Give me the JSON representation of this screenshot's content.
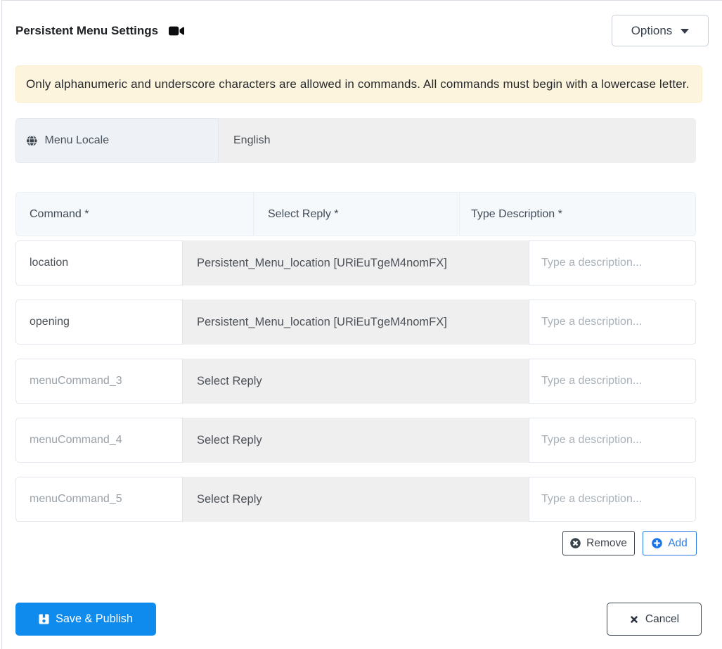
{
  "header": {
    "title": "Persistent Menu Settings",
    "options_label": "Options"
  },
  "alert": {
    "text": "Only alphanumeric and underscore characters are allowed in commands. All commands must begin with a lowercase letter."
  },
  "locale": {
    "label": "Menu Locale",
    "value": "English"
  },
  "table": {
    "columns": [
      "Command *",
      "Select Reply *",
      "Type Description *"
    ],
    "rows": [
      {
        "command": "location",
        "command_placeholder": "",
        "reply": "Persistent_Menu_location [URiEuTgeM4nomFX]",
        "description_value": "",
        "description_placeholder": "Type a description..."
      },
      {
        "command": "opening",
        "command_placeholder": "",
        "reply": "Persistent_Menu_location [URiEuTgeM4nomFX]",
        "description_value": "",
        "description_placeholder": "Type a description..."
      },
      {
        "command": "",
        "command_placeholder": "menuCommand_3",
        "reply": "Select Reply",
        "description_value": "",
        "description_placeholder": "Type a description..."
      },
      {
        "command": "",
        "command_placeholder": "menuCommand_4",
        "reply": "Select Reply",
        "description_value": "",
        "description_placeholder": "Type a description..."
      },
      {
        "command": "",
        "command_placeholder": "menuCommand_5",
        "reply": "Select Reply",
        "description_value": "",
        "description_placeholder": "Type a description..."
      }
    ]
  },
  "actions": {
    "remove_label": "Remove",
    "add_label": "Add"
  },
  "footer": {
    "save_label": "Save & Publish",
    "cancel_label": "Cancel"
  },
  "colors": {
    "primary": "#0f8bee",
    "alert-bg": "#fcf4dc",
    "alert-border": "#f9edca",
    "card-border": "#d9dde3"
  }
}
